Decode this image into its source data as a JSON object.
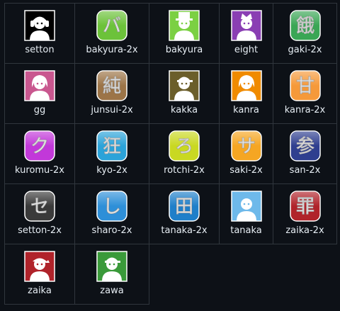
{
  "cells": [
    {
      "label": "setton",
      "icon": "setton-icon",
      "kind": "avatar",
      "bg": "#000000",
      "fg": "#ffffff",
      "variant": "headphones"
    },
    {
      "label": "bakyura-2x",
      "icon": "bakyura-2x-icon",
      "kind": "kanji",
      "glyph": "バ",
      "bg": "#6cc23a",
      "fg": "#ffffff"
    },
    {
      "label": "bakyura",
      "icon": "bakyura-icon",
      "kind": "avatar",
      "bg": "#7bd043",
      "fg": "#ffffff",
      "variant": "tophat"
    },
    {
      "label": "eight",
      "icon": "eight-icon",
      "kind": "avatar",
      "bg": "#8a3fb3",
      "fg": "#ffffff",
      "variant": "crown"
    },
    {
      "label": "gaki-2x",
      "icon": "gaki-2x-icon",
      "kind": "kanji",
      "glyph": "餓",
      "bg": "#3aa655",
      "fg": "#ffffff"
    },
    {
      "label": "gg",
      "icon": "gg-icon",
      "kind": "avatar",
      "bg": "#c9578f",
      "fg": "#ffffff",
      "variant": "hair"
    },
    {
      "label": "junsui-2x",
      "icon": "junsui-2x-icon",
      "kind": "kanji",
      "glyph": "純",
      "bg": "#9c7447",
      "fg": "#ffffff"
    },
    {
      "label": "kakka",
      "icon": "kakka-icon",
      "kind": "avatar",
      "bg": "#6b5e2a",
      "fg": "#ffffff",
      "variant": "cap"
    },
    {
      "label": "kanra",
      "icon": "kanra-icon",
      "kind": "avatar",
      "bg": "#f08b00",
      "fg": "#ffffff",
      "variant": "hair"
    },
    {
      "label": "kanra-2x",
      "icon": "kanra-2x-icon",
      "kind": "kanji",
      "glyph": "甘",
      "bg": "#f5993a",
      "fg": "#ffffff"
    },
    {
      "label": "kuromu-2x",
      "icon": "kuromu-2x-icon",
      "kind": "kanji",
      "glyph": "ク",
      "bg": "#c238d9",
      "fg": "#ffffff"
    },
    {
      "label": "kyo-2x",
      "icon": "kyo-2x-icon",
      "kind": "kanji",
      "glyph": "狂",
      "bg": "#2ba3d9",
      "fg": "#ffffff"
    },
    {
      "label": "rotchi-2x",
      "icon": "rotchi-2x-icon",
      "kind": "kanji",
      "glyph": "ろ",
      "bg": "#c9d822",
      "fg": "#ffffff"
    },
    {
      "label": "saki-2x",
      "icon": "saki-2x-icon",
      "kind": "kanji",
      "glyph": "サ",
      "bg": "#f5a623",
      "fg": "#ffffff"
    },
    {
      "label": "san-2x",
      "icon": "san-2x-icon",
      "kind": "kanji",
      "glyph": "参",
      "bg": "#2f3f8f",
      "fg": "#ffffff"
    },
    {
      "label": "setton-2x",
      "icon": "setton-2x-icon",
      "kind": "kanji",
      "glyph": "セ",
      "bg": "#3a3a3a",
      "fg": "#ffffff"
    },
    {
      "label": "sharo-2x",
      "icon": "sharo-2x-icon",
      "kind": "kanji",
      "glyph": "し",
      "bg": "#2e8fd8",
      "fg": "#ffffff"
    },
    {
      "label": "tanaka-2x",
      "icon": "tanaka-2x-icon",
      "kind": "kanji",
      "glyph": "田",
      "bg": "#1f7fc9",
      "fg": "#ffffff"
    },
    {
      "label": "tanaka",
      "icon": "tanaka-icon",
      "kind": "avatar",
      "bg": "#6eb9ea",
      "fg": "#ffffff",
      "variant": "plain"
    },
    {
      "label": "zaika-2x",
      "icon": "zaika-2x-icon",
      "kind": "kanji",
      "glyph": "罪",
      "bg": "#b0232a",
      "fg": "#ffffff"
    },
    {
      "label": "zaika",
      "icon": "zaika-icon",
      "kind": "avatar",
      "bg": "#b0232a",
      "fg": "#ffffff",
      "variant": "bandana"
    },
    {
      "label": "zawa",
      "icon": "zawa-icon",
      "kind": "avatar",
      "bg": "#3a9a3a",
      "fg": "#ffffff",
      "variant": "cap"
    }
  ]
}
